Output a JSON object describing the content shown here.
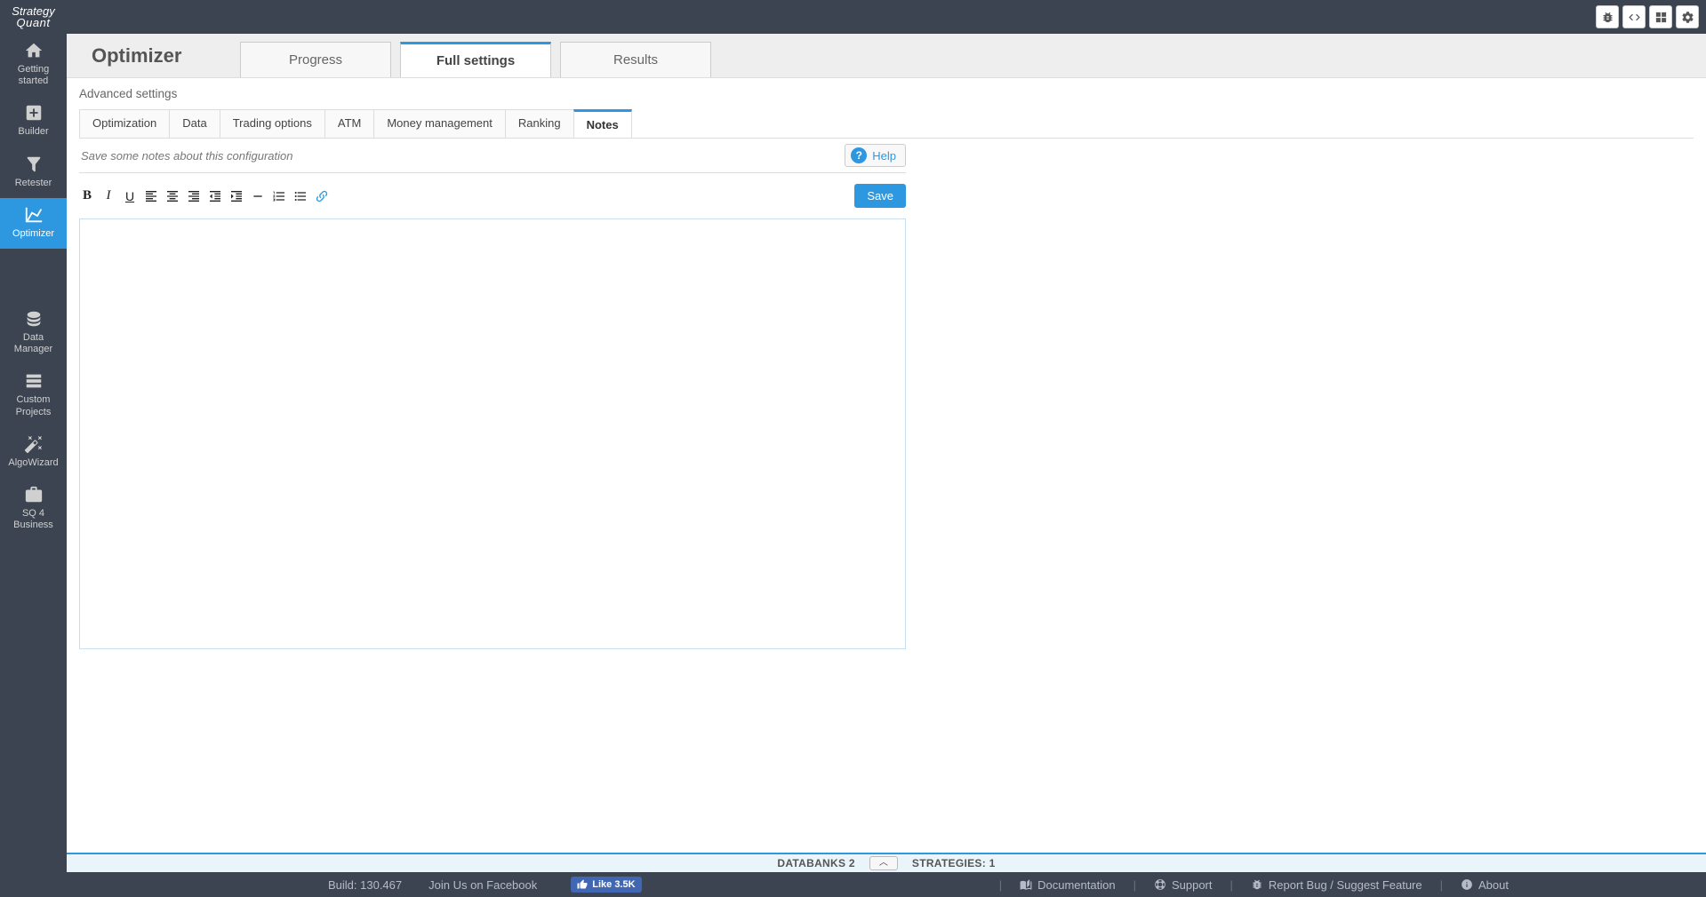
{
  "logo": {
    "line1": "Strategy",
    "line2": "Quant"
  },
  "topbar_icons": [
    "bug-icon",
    "code-icon",
    "grid-icon",
    "gear-icon"
  ],
  "sidebar": [
    {
      "icon": "home",
      "label": "Getting started"
    },
    {
      "icon": "plus-box",
      "label": "Builder"
    },
    {
      "icon": "filter",
      "label": "Retester"
    },
    {
      "icon": "chart-line",
      "label": "Optimizer",
      "active": true
    }
  ],
  "sidebar2": [
    {
      "icon": "database",
      "label": "Data Manager"
    },
    {
      "icon": "layers",
      "label": "Custom Projects"
    },
    {
      "icon": "wand",
      "label": "AlgoWizard"
    },
    {
      "icon": "briefcase",
      "label": "SQ 4 Business"
    }
  ],
  "page_title": "Optimizer",
  "main_tabs": [
    {
      "label": "Progress"
    },
    {
      "label": "Full settings",
      "active": true
    },
    {
      "label": "Results"
    }
  ],
  "advanced_label": "Advanced settings",
  "sub_tabs": [
    {
      "label": "Optimization"
    },
    {
      "label": "Data"
    },
    {
      "label": "Trading options"
    },
    {
      "label": "ATM"
    },
    {
      "label": "Money management"
    },
    {
      "label": "Ranking"
    },
    {
      "label": "Notes",
      "active": true
    }
  ],
  "notes_hint": "Save some notes about this configuration",
  "help_label": "Help",
  "save_label": "Save",
  "databanks": {
    "label1": "DATABANKS 2",
    "label2": "STRATEGIES: 1"
  },
  "footer": {
    "build": "Build: 130.467",
    "join": "Join Us on Facebook",
    "like": "Like 3.5K",
    "documentation": "Documentation",
    "support": "Support",
    "report": "Report Bug / Suggest Feature",
    "about": "About"
  }
}
